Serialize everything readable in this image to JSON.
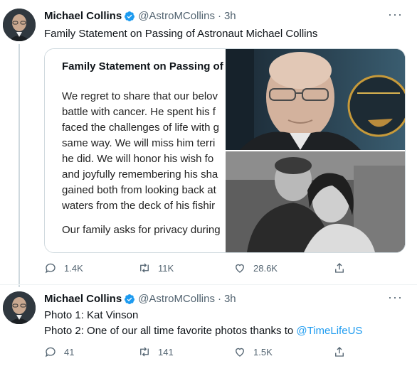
{
  "tweets": [
    {
      "name": "Michael Collins",
      "handle": "@AstroMCollins",
      "dot": "·",
      "time": "3h",
      "text_lines": [
        "Family Statement on Passing of Astronaut Michael Collins"
      ],
      "media": {
        "doc_title": "Family Statement on Passing of A",
        "doc_lines": [
          "We regret to share that our belov",
          "battle with cancer. He spent his f",
          "faced the challenges of life with g",
          "same way. We will miss him terri",
          "he did. We will honor his wish fo",
          "and joyfully remembering his sha",
          "gained both from looking back at",
          "waters from the deck of his fishir"
        ],
        "doc_closing": "Our family asks for privacy during"
      },
      "actions": {
        "replies": "1.4K",
        "retweets": "11K",
        "likes": "28.6K"
      }
    },
    {
      "name": "Michael Collins",
      "handle": "@AstroMCollins",
      "dot": "·",
      "time": "3h",
      "text_line1": "Photo 1: Kat Vinson",
      "text_line2_prefix": "Photo 2: One of our all time favorite photos thanks to ",
      "text_line2_link": "@TimeLifeUS",
      "actions": {
        "replies": "41",
        "retweets": "141",
        "likes": "1.5K"
      }
    }
  ],
  "more_label": "···",
  "colors": {
    "accent": "#1d9bf0",
    "secondary_text": "#536471",
    "border": "#cfd9de"
  }
}
